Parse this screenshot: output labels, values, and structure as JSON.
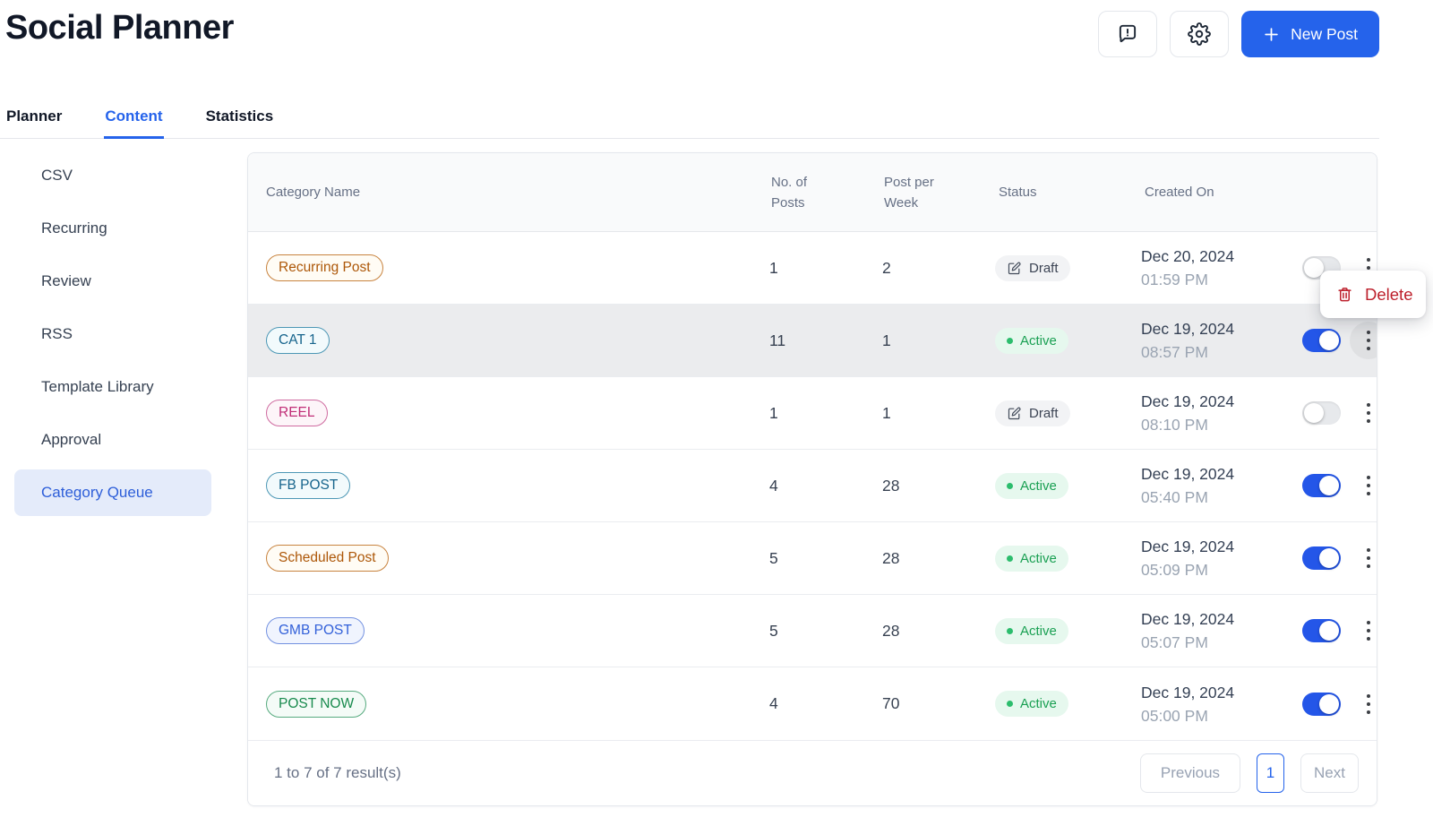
{
  "header": {
    "title": "Social Planner",
    "new_post_label": "New Post"
  },
  "tabs": [
    {
      "label": "Planner",
      "active": false
    },
    {
      "label": "Content",
      "active": true
    },
    {
      "label": "Statistics",
      "active": false
    }
  ],
  "sidebar": {
    "items": [
      {
        "label": "CSV",
        "active": false
      },
      {
        "label": "Recurring",
        "active": false
      },
      {
        "label": "Review",
        "active": false
      },
      {
        "label": "RSS",
        "active": false
      },
      {
        "label": "Template Library",
        "active": false
      },
      {
        "label": "Approval",
        "active": false
      },
      {
        "label": "Category Queue",
        "active": true
      }
    ]
  },
  "table": {
    "columns": [
      "Category Name",
      "No. of Posts",
      "Post per Week",
      "Status",
      "Created On"
    ],
    "rows": [
      {
        "category": "Recurring Post",
        "color": "amber",
        "posts": "1",
        "per_week": "2",
        "status": "Draft",
        "date": "Dec 20, 2024",
        "time": "01:59 PM",
        "enabled": false,
        "highlighted": false,
        "menu_open": false
      },
      {
        "category": "CAT 1",
        "color": "teal",
        "posts": "11",
        "per_week": "1",
        "status": "Active",
        "date": "Dec 19, 2024",
        "time": "08:57 PM",
        "enabled": true,
        "highlighted": true,
        "menu_open": true
      },
      {
        "category": "REEL",
        "color": "pink",
        "posts": "1",
        "per_week": "1",
        "status": "Draft",
        "date": "Dec 19, 2024",
        "time": "08:10 PM",
        "enabled": false,
        "highlighted": false,
        "menu_open": false
      },
      {
        "category": "FB POST",
        "color": "teal",
        "posts": "4",
        "per_week": "28",
        "status": "Active",
        "date": "Dec 19, 2024",
        "time": "05:40 PM",
        "enabled": true,
        "highlighted": false,
        "menu_open": false
      },
      {
        "category": "Scheduled Post",
        "color": "amber",
        "posts": "5",
        "per_week": "28",
        "status": "Active",
        "date": "Dec 19, 2024",
        "time": "05:09 PM",
        "enabled": true,
        "highlighted": false,
        "menu_open": false
      },
      {
        "category": "GMB POST",
        "color": "blue",
        "posts": "5",
        "per_week": "28",
        "status": "Active",
        "date": "Dec 19, 2024",
        "time": "05:07 PM",
        "enabled": true,
        "highlighted": false,
        "menu_open": false
      },
      {
        "category": "POST NOW",
        "color": "green",
        "posts": "4",
        "per_week": "70",
        "status": "Active",
        "date": "Dec 19, 2024",
        "time": "05:00 PM",
        "enabled": true,
        "highlighted": false,
        "menu_open": false
      }
    ]
  },
  "context_menu": {
    "items": [
      {
        "label": "Delete",
        "icon": "trash-icon",
        "color": "#bd202c"
      }
    ]
  },
  "footer": {
    "results_text": "1 to 7 of 7 result(s)",
    "previous_label": "Previous",
    "current_page": "1",
    "next_label": "Next"
  },
  "colors": {
    "accent_blue": "#2563eb",
    "toggle_on_blue": "#2456e8",
    "active_green": "#1aa053",
    "delete_red": "#bd202c",
    "row_highlight": "#ebecee",
    "sidebar_active_bg": "#e4ebfa"
  }
}
